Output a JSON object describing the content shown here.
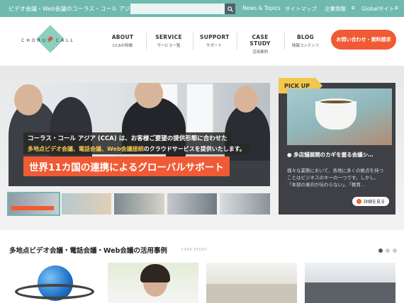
{
  "topbar": {
    "site_name": "ビデオ会議・Web会議のコーラス・コール アジア",
    "search_placeholder": "",
    "links": [
      "News & Topics",
      "サイトマップ",
      "企業情報",
      "Globalサイト"
    ]
  },
  "logo": {
    "text": "CHORUS CALL"
  },
  "nav": [
    {
      "en": "ABOUT",
      "jp": "CCAの特徴"
    },
    {
      "en": "SERVICE",
      "jp": "サービス一覧"
    },
    {
      "en": "SUPPORT",
      "jp": "サポート"
    },
    {
      "en": "CASE STUDY",
      "jp": "活用事例"
    },
    {
      "en": "BLOG",
      "jp": "情報コンテンツ"
    }
  ],
  "cta_label": "お問い合わせ・資料請求",
  "hero": {
    "line1": "コーラス・コール アジア (CCA) は、お客様ご要望の提供形態に合わせた",
    "line2_highlight": "多地点ビデオ会議、電話会議、Web会議接続",
    "line2_rest": "のクラウドサービスを提供いたします。",
    "line3": "世界11カ国の連携によるグローバルサポート"
  },
  "pickup": {
    "label": "PICK UP",
    "title": "多店舗展開のカギを握る会議シ…",
    "body": [
      "様々な業態において、各地に多くの拠点を持つ",
      "ことはビジネスのキーの一つです。しかし、",
      "「本部の意向が伝わらない」、「教育…"
    ],
    "detail_label": "詳細を見る"
  },
  "case_study": {
    "title": "多地点ビデオ会議・電話会議・Web会議の活用事例",
    "subtitle": "CASE STUDY"
  },
  "colors": {
    "accent": "#6fb9b1",
    "cta": "#f05a34",
    "pickup_label": "#f2c74b"
  }
}
